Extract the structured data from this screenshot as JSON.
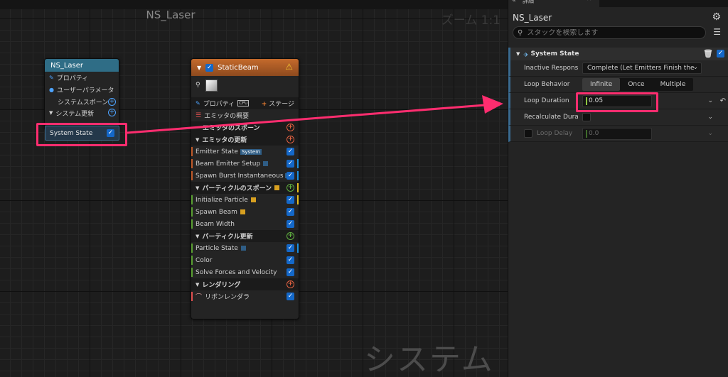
{
  "graph": {
    "title": "NS_Laser",
    "zoom": "ズーム 1:1",
    "watermark": "システム"
  },
  "system_node": {
    "title": "NS_Laser",
    "rows": [
      {
        "label": "プロパティ"
      },
      {
        "label": "ユーザーパラメータ"
      },
      {
        "label": "システムスポーン"
      },
      {
        "label": "システム更新"
      }
    ],
    "pill_label": "System State"
  },
  "emitter_node": {
    "title": "StaticBeam",
    "properties_label": "プロパティ",
    "cpu_badge": "CPU",
    "stage_label": "ステージ",
    "summary_label": "エミッタの概要",
    "spawn_label": "エミッタのスポーン",
    "update_header": "エミッタの更新",
    "update_items": [
      {
        "label": "Emitter State",
        "tag": "System"
      },
      {
        "label": "Beam Emitter Setup"
      },
      {
        "label": "Spawn Burst Instantaneous"
      }
    ],
    "particle_spawn_header": "パーティクルのスポーン",
    "particle_spawn_items": [
      {
        "label": "Initialize Particle"
      },
      {
        "label": "Spawn Beam"
      },
      {
        "label": "Beam Width"
      }
    ],
    "particle_update_header": "パーティクル更新",
    "particle_update_items": [
      {
        "label": "Particle State"
      },
      {
        "label": "Color"
      },
      {
        "label": "Solve Forces and Velocity"
      }
    ],
    "render_header": "レンダリング",
    "render_items": [
      {
        "label": "リボンレンダラ"
      }
    ]
  },
  "details": {
    "tab_label": "詳細",
    "title": "NS_Laser",
    "search_placeholder": "スタックを検索します",
    "section_title": "System State",
    "inactive_label": "Inactive Respons",
    "inactive_value": "Complete (Let Emitters Finish the",
    "loop_behavior_label": "Loop Behavior",
    "loop_behavior_options": [
      "Infinite",
      "Once",
      "Multiple"
    ],
    "loop_behavior_selected": "Infinite",
    "loop_duration_label": "Loop Duration",
    "loop_duration_value": "0.05",
    "recalc_label": "Recalculate Dura",
    "loop_delay_label": "Loop Delay",
    "loop_delay_value": "0.0"
  },
  "colors": {
    "highlight": "#ff2d6f",
    "system_header": "#2f6d86",
    "emitter_header": "#c46a2c",
    "check_blue": "#1468c9"
  }
}
